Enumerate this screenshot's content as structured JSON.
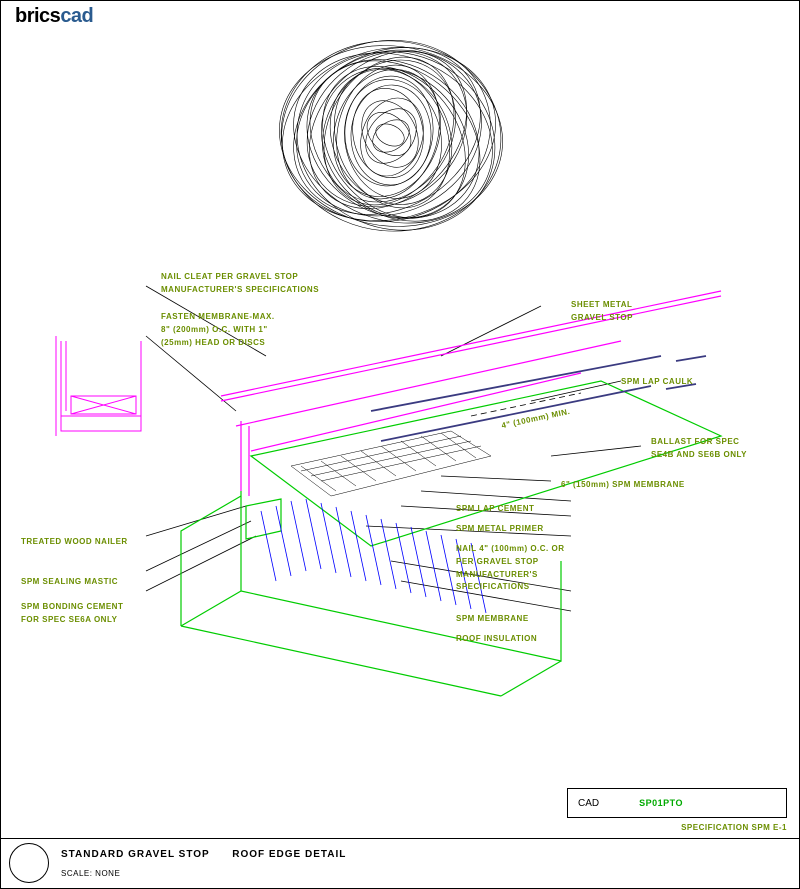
{
  "logo_brics": "brics",
  "logo_cad": "cad",
  "annotations": {
    "nail_cleat": "NAIL CLEAT PER GRAVEL STOP\nMANUFACTURER'S SPECIFICATIONS",
    "fasten_membrane": "FASTEN MEMBRANE-MAX.\n8\" (200mm) O.C. WITH 1\"\n(25mm) HEAD OR DISCS",
    "sheet_metal": "SHEET METAL\nGRAVEL STOP",
    "spm_lap_caulk": "SPM LAP CAULK",
    "dimension": "4\" (100mm) MIN.",
    "ballast": "BALLAST FOR SPEC\nSE4B AND SE6B ONLY",
    "membrane_150": "6\" (150mm) SPM MEMBRANE",
    "spm_lap_cement": "SPM LAP CEMENT",
    "spm_metal_primer": "SPM METAL PRIMER",
    "nail_4": "NAIL 4\" (100mm) O.C. OR\nPER GRAVEL STOP\nMANUFACTURER'S\nSPECIFICATIONS",
    "spm_membrane": "SPM MEMBRANE",
    "roof_insulation": "ROOF INSULATION",
    "treated_wood": "TREATED WOOD NAILER",
    "spm_sealing": "SPM SEALING MASTIC",
    "spm_bonding": "SPM BONDING CEMENT\nFOR SPEC SE6A ONLY"
  },
  "cad_box": {
    "label": "CAD",
    "code": "SP01PTO"
  },
  "spec_code": "SPECIFICATION SPM E-1",
  "title": {
    "main": "STANDARD GRAVEL STOP",
    "sub": "ROOF EDGE DETAIL",
    "scale": "SCALE: NONE"
  }
}
